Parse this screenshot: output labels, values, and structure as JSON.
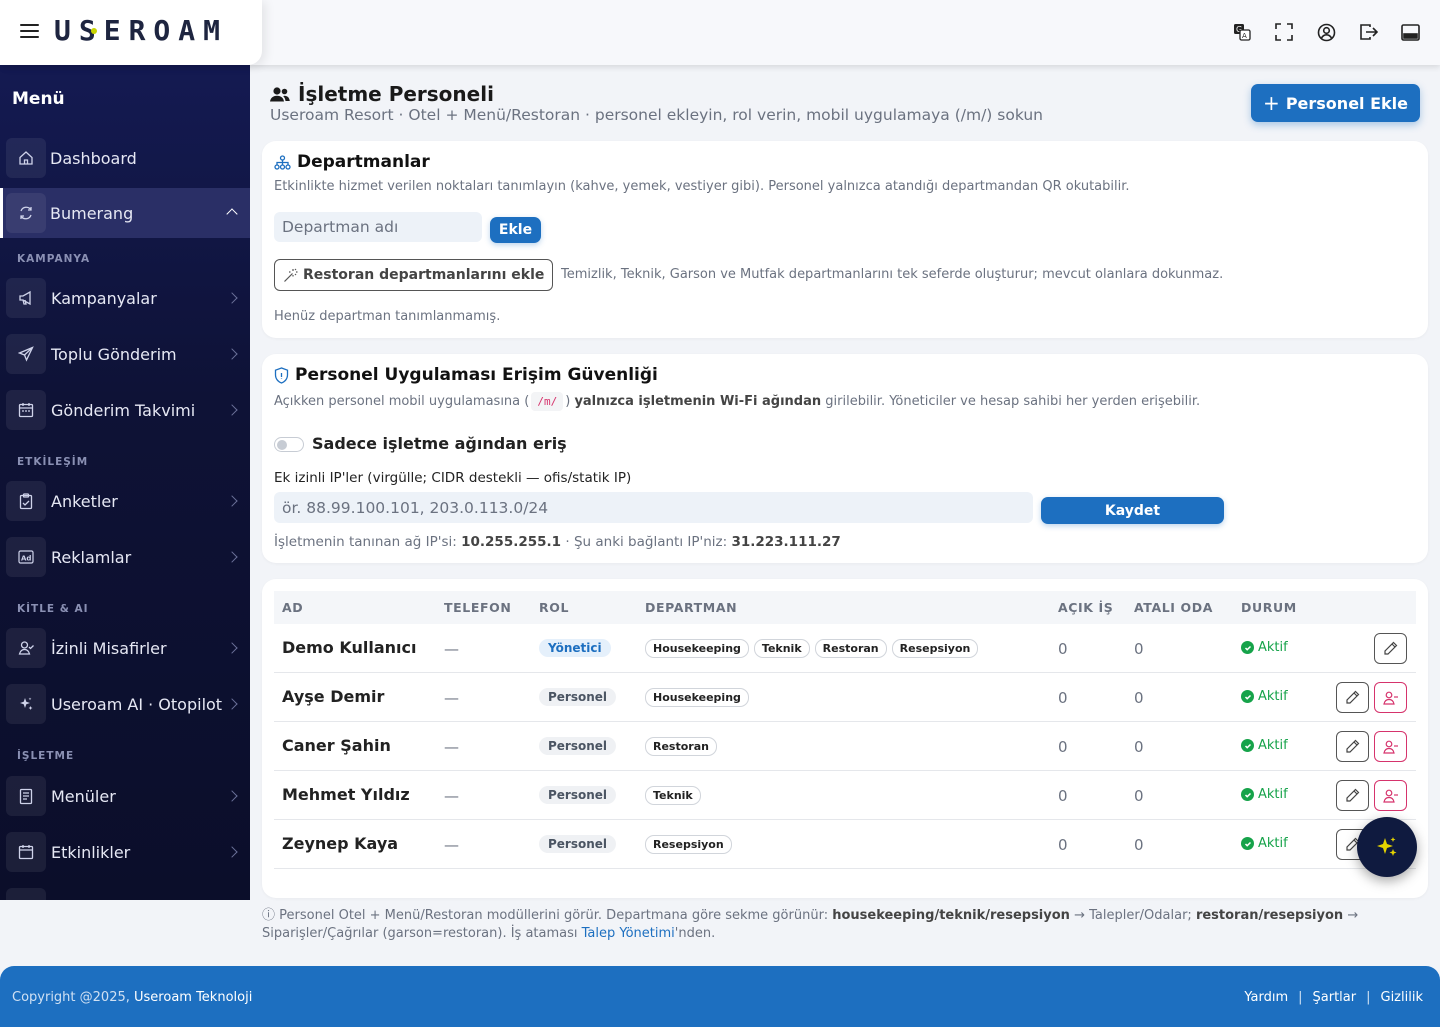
{
  "brand": {
    "logo_text": "USEROAM"
  },
  "sidebar": {
    "title": "Menü",
    "items": [
      {
        "label": "Dashboard"
      },
      {
        "label": "Bumerang"
      },
      {
        "label": "Kampanyalar"
      },
      {
        "label": "Toplu Gönderim"
      },
      {
        "label": "Gönderim Takvimi"
      },
      {
        "label": "Anketler"
      },
      {
        "label": "Reklamlar"
      },
      {
        "label": "İzinli Misafirler"
      },
      {
        "label": "Useroam AI · Otopilot"
      },
      {
        "label": "Menüler"
      },
      {
        "label": "Etkinlikler"
      }
    ],
    "sections": [
      "KAMPANYA",
      "ETKİLEŞİM",
      "KİTLE & AI",
      "İŞLETME"
    ]
  },
  "header": {
    "title": "İşletme Personeli",
    "subtitle": "Useroam Resort · Otel + Menü/Restoran · personel ekleyin, rol verin, mobil uygulamaya (/m/) sokun",
    "add_button": "Personel Ekle"
  },
  "departments": {
    "title": "Departmanlar",
    "desc": "Etkinlikte hizmet verilen noktaları tanımlayın (kahve, yemek, vestiyer gibi). Personel yalnızca atandığı departmandan QR okutabilir.",
    "input_placeholder": "Departman adı",
    "add_button": "Ekle",
    "preset_button": "Restoran departmanlarını ekle",
    "preset_desc": "Temizlik, Teknik, Garson ve Mutfak departmanlarını tek seferde oluşturur; mevcut olanlara dokunmaz.",
    "empty_text": "Henüz departman tanımlanmamış."
  },
  "security": {
    "title": "Personel Uygulaması Erişim Güvenliği",
    "desc_pre": "Açıkken personel mobil uygulamasına (",
    "desc_code": "/m/",
    "desc_mid": ") ",
    "desc_bold": "yalnızca işletmenin Wi-Fi ağından",
    "desc_post": " girilebilir. Yöneticiler ve hesap sahibi her yerden erişebilir.",
    "toggle_label": "Sadece işletme ağından eriş",
    "toggle_on": false,
    "ip_label": "Ek izinli IP'ler (virgülle; CIDR destekli — ofis/statik IP)",
    "ip_placeholder": "ör. 88.99.100.101, 203.0.113.0/24",
    "save_button": "Kaydet",
    "known_ip_label": "İşletmenin tanınan ağ IP'si:",
    "known_ip": "10.255.255.1",
    "current_ip_label": "· Şu anki bağlantı IP'niz:",
    "current_ip": "31.223.111.27"
  },
  "table": {
    "headers": [
      "AD",
      "TELEFON",
      "ROL",
      "DEPARTMAN",
      "AÇIK İŞ",
      "ATALI ODA",
      "DURUM"
    ],
    "rows": [
      {
        "name": "Demo Kullanıcı",
        "phone": "—",
        "role": "Yönetici",
        "departments": [
          "Housekeeping",
          "Teknik",
          "Restoran",
          "Resepsiyon"
        ],
        "open_jobs": "0",
        "rooms": "0",
        "status": "Aktif"
      },
      {
        "name": "Ayşe Demir",
        "phone": "—",
        "role": "Personel",
        "departments": [
          "Housekeeping"
        ],
        "open_jobs": "0",
        "rooms": "0",
        "status": "Aktif"
      },
      {
        "name": "Caner Şahin",
        "phone": "—",
        "role": "Personel",
        "departments": [
          "Restoran"
        ],
        "open_jobs": "0",
        "rooms": "0",
        "status": "Aktif"
      },
      {
        "name": "Mehmet Yıldız",
        "phone": "—",
        "role": "Personel",
        "departments": [
          "Teknik"
        ],
        "open_jobs": "0",
        "rooms": "0",
        "status": "Aktif"
      },
      {
        "name": "Zeynep Kaya",
        "phone": "—",
        "role": "Personel",
        "departments": [
          "Resepsiyon"
        ],
        "open_jobs": "0",
        "rooms": "0",
        "status": "Aktif"
      }
    ]
  },
  "note": {
    "pre": "Personel Otel + Menü/Restoran modüllerini görür. Departmana göre sekme görünür: ",
    "b1": "housekeeping/teknik/resepsiyon",
    "mid1": " → Talepler/Odalar; ",
    "b2": "restoran/resepsiyon",
    "mid2": " → Siparişler/Çağrılar (garson=restoran). İş ataması ",
    "link": "Talep Yönetimi",
    "post": "'nden."
  },
  "footer": {
    "copyright": "Copyright @2025,",
    "company": "Useroam Teknoloji",
    "links": [
      "Yardım",
      "Şartlar",
      "Gizlilik"
    ]
  },
  "colors": {
    "primary": "#1d6fc0",
    "sidebar": "#0e1236",
    "success": "#16a34a",
    "danger": "#d6336c"
  }
}
